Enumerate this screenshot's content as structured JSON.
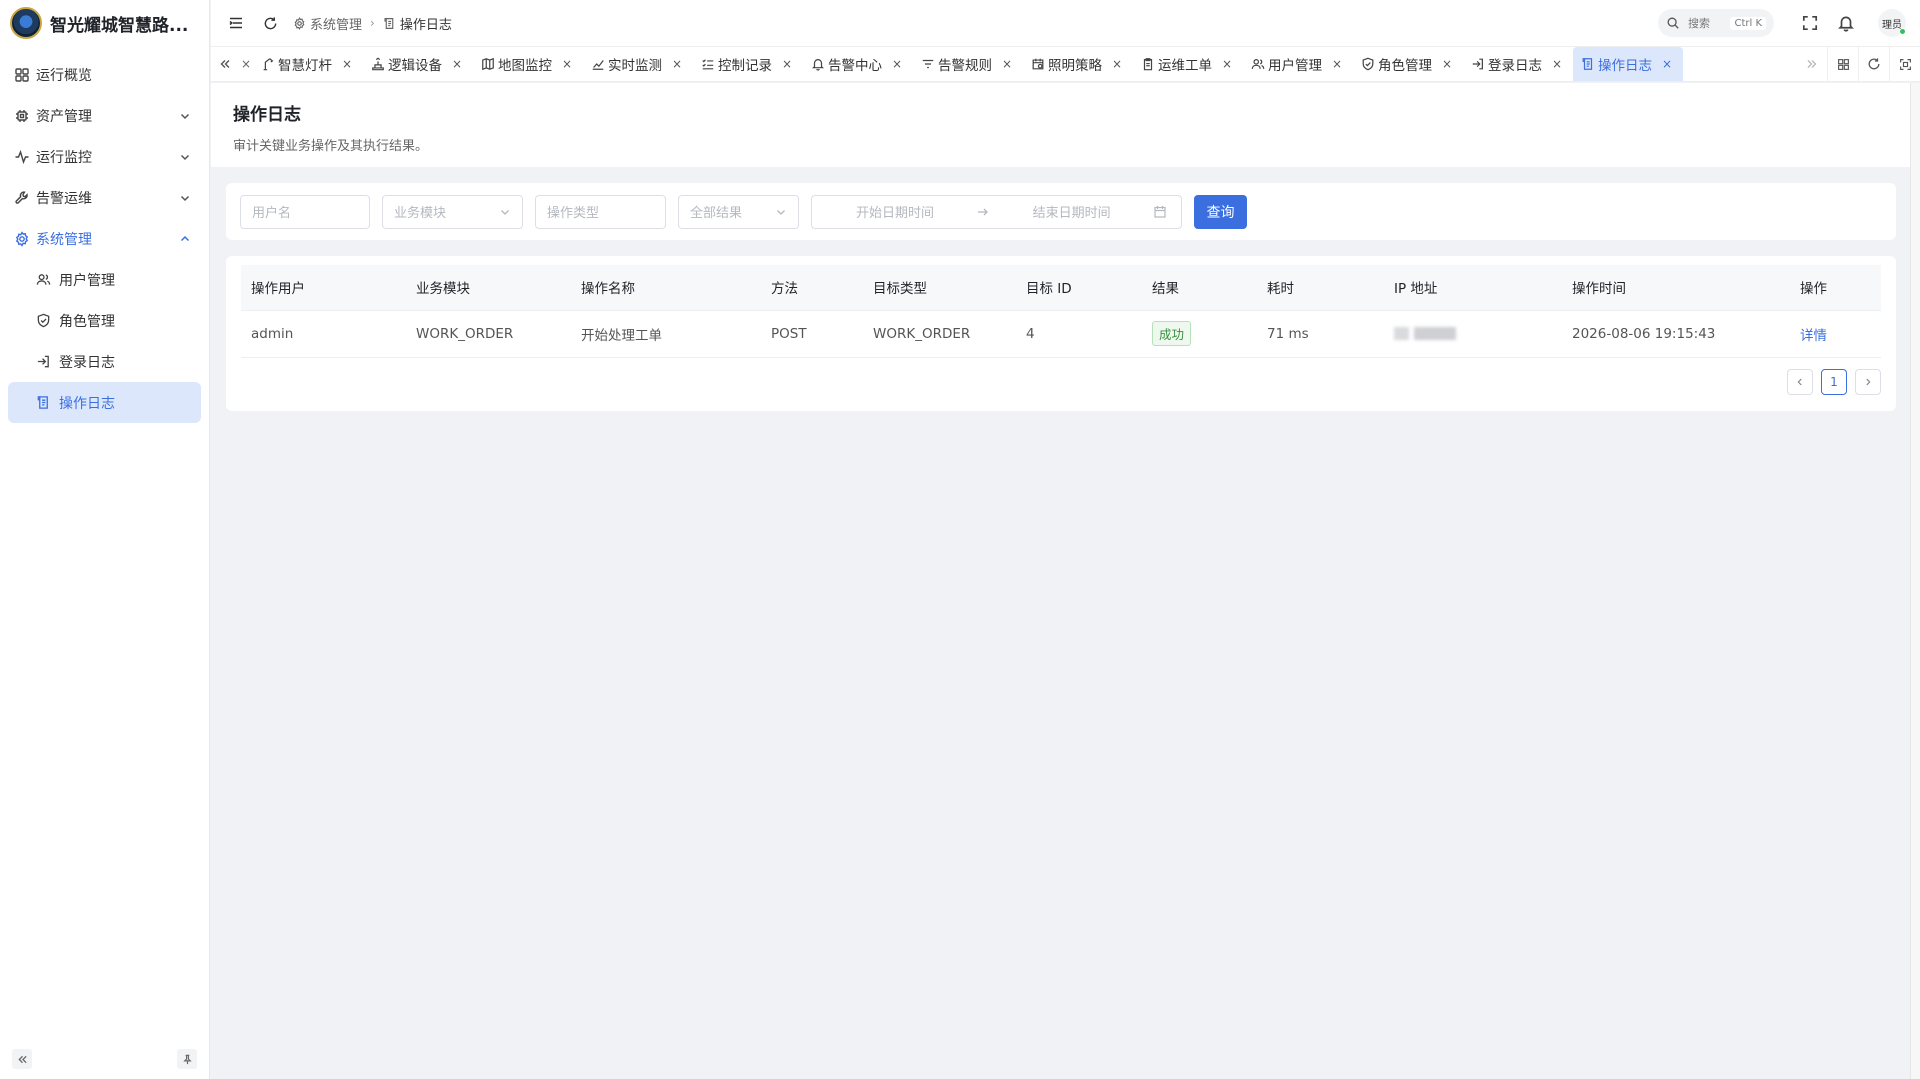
{
  "app": {
    "name": "智光耀城智慧路..."
  },
  "sidebar": {
    "items": [
      {
        "label": "运行概览",
        "icon": "dashboard-icon"
      },
      {
        "label": "资产管理",
        "icon": "chip-icon"
      },
      {
        "label": "运行监控",
        "icon": "activity-icon"
      },
      {
        "label": "告警运维",
        "icon": "wrench-icon"
      },
      {
        "label": "系统管理",
        "icon": "gear-icon"
      }
    ],
    "sub_items": [
      {
        "label": "用户管理",
        "icon": "users-icon"
      },
      {
        "label": "角色管理",
        "icon": "shield-icon"
      },
      {
        "label": "登录日志",
        "icon": "login-icon"
      },
      {
        "label": "操作日志",
        "icon": "log-icon"
      }
    ]
  },
  "breadcrumb": {
    "parent": "系统管理",
    "current": "操作日志"
  },
  "header": {
    "search_placeholder": "搜索",
    "search_shortcut": "Ctrl K",
    "avatar_text": "理员"
  },
  "tabs": [
    {
      "label": "智慧灯杆"
    },
    {
      "label": "逻辑设备"
    },
    {
      "label": "地图监控"
    },
    {
      "label": "实时监测"
    },
    {
      "label": "控制记录"
    },
    {
      "label": "告警中心"
    },
    {
      "label": "告警规则"
    },
    {
      "label": "照明策略"
    },
    {
      "label": "运维工单"
    },
    {
      "label": "用户管理"
    },
    {
      "label": "角色管理"
    },
    {
      "label": "登录日志"
    },
    {
      "label": "操作日志"
    }
  ],
  "page": {
    "title": "操作日志",
    "description": "审计关键业务操作及其执行结果。"
  },
  "filters": {
    "username_placeholder": "用户名",
    "module_placeholder": "业务模块",
    "op_type_placeholder": "操作类型",
    "result_placeholder": "全部结果",
    "start_placeholder": "开始日期时间",
    "end_placeholder": "结束日期时间",
    "query_label": "查询"
  },
  "table": {
    "headers": [
      "操作用户",
      "业务模块",
      "操作名称",
      "方法",
      "目标类型",
      "目标 ID",
      "结果",
      "耗时",
      "IP 地址",
      "操作时间",
      "操作"
    ],
    "rows": [
      {
        "user": "admin",
        "module": "WORK_ORDER",
        "op_name": "开始处理工单",
        "method": "POST",
        "target_type": "WORK_ORDER",
        "target_id": "4",
        "result": "成功",
        "duration": "71 ms",
        "ip": "",
        "time": "2026-08-06 19:15:43",
        "action": "详情"
      }
    ]
  },
  "pagination": {
    "current": "1"
  },
  "colors": {
    "accent": "#3b6fe0",
    "accent_bg": "#dde7fb",
    "success": "#3a8f3f"
  }
}
